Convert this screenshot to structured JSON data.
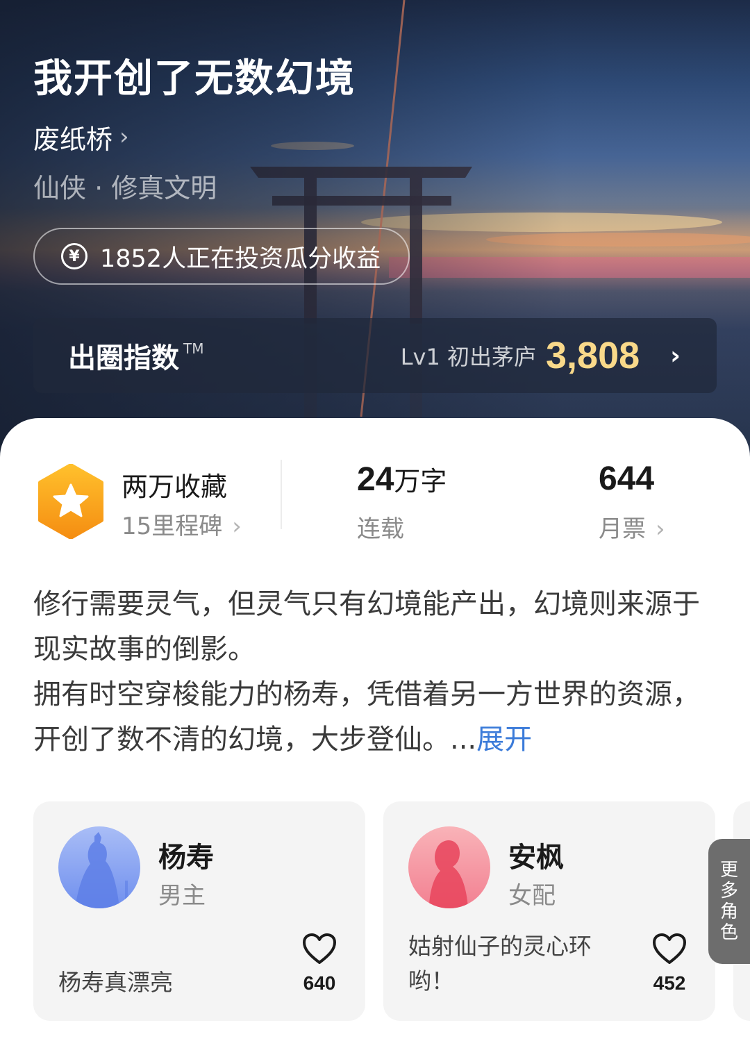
{
  "book": {
    "title": "我开创了无数幻境",
    "author": "废纸桥",
    "author_chevron": "›",
    "genre": "仙侠 · 修真文明"
  },
  "invest": {
    "icon": "yen-icon",
    "symbol": "¥",
    "text": "1852人正在投资瓜分收益"
  },
  "index": {
    "label": "出圈指数",
    "tm": "TM",
    "level": "Lv1 初出茅庐",
    "score": "3,808",
    "chevron": "›",
    "score_color": "#f9d98a"
  },
  "stats": {
    "favorites": {
      "title": "两万收藏",
      "sub": "15里程碑",
      "chevron": "›",
      "badge_icon": "star-icon",
      "badge_color": "#f7a21b"
    },
    "words": {
      "number": "24",
      "unit": "万字",
      "label": "连载"
    },
    "tickets": {
      "value": "644",
      "label": "月票",
      "chevron": "›"
    }
  },
  "synopsis": {
    "para1": "修行需要灵气，但灵气只有幻境能产出，幻境则来源于现实故事的倒影。",
    "para2": "拥有时空穿梭能力的杨寿，凭借着另一方世界的资源，开创了数不清的幻境，大步登仙。...",
    "expand": "展开",
    "link_color": "#3b7bd9"
  },
  "characters": [
    {
      "name": "杨寿",
      "role": "男主",
      "quote": "杨寿真漂亮",
      "likes": "640",
      "avatar_color": "#7e9cf0"
    },
    {
      "name": "安枫",
      "role": "女配",
      "quote": "姑射仙子的灵心环哟！",
      "likes": "452",
      "avatar_color": "#f07c88"
    }
  ],
  "more_roles": {
    "label": [
      "更",
      "多",
      "角",
      "色"
    ]
  }
}
